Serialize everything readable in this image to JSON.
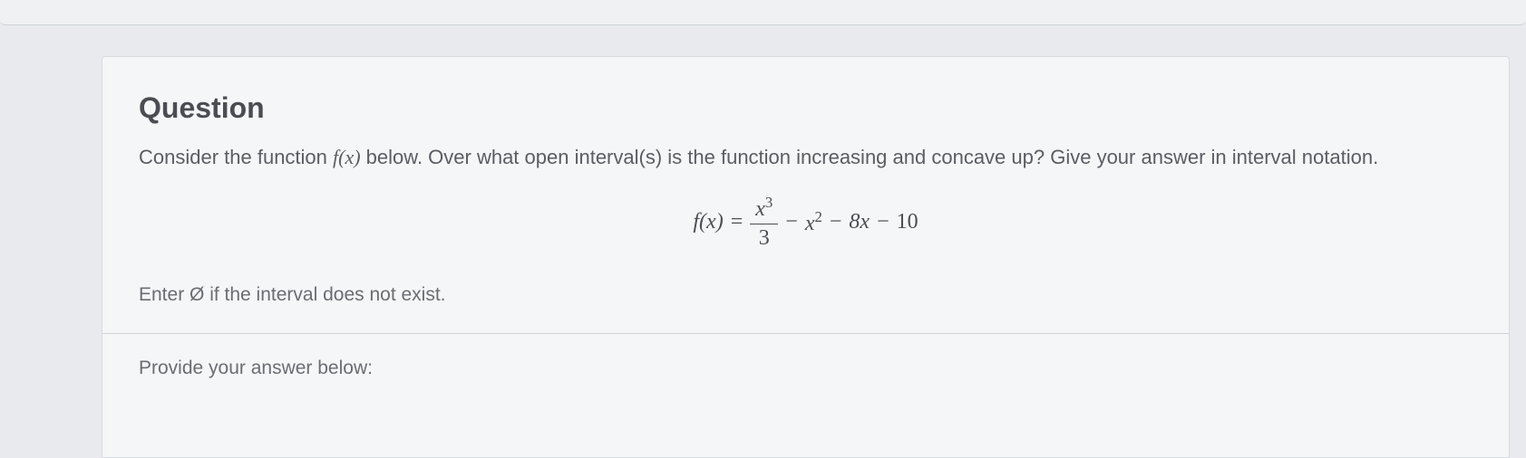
{
  "heading": "Question",
  "prompt_pre": "Consider the function ",
  "prompt_fx": "f(x)",
  "prompt_post": " below. Over what open interval(s) is the function increasing and concave up? Give your answer in interval notation.",
  "equation": {
    "lhs": "f(x)",
    "eq": "=",
    "frac_num": "x",
    "frac_num_exp": "3",
    "frac_den": "3",
    "minus1": "−",
    "term2_base": "x",
    "term2_exp": "2",
    "minus2": "−",
    "term3": "8x",
    "minus3": "−",
    "term4": "10"
  },
  "note": "Enter Ø if the interval does not exist.",
  "answer_label": "Provide your answer below:"
}
